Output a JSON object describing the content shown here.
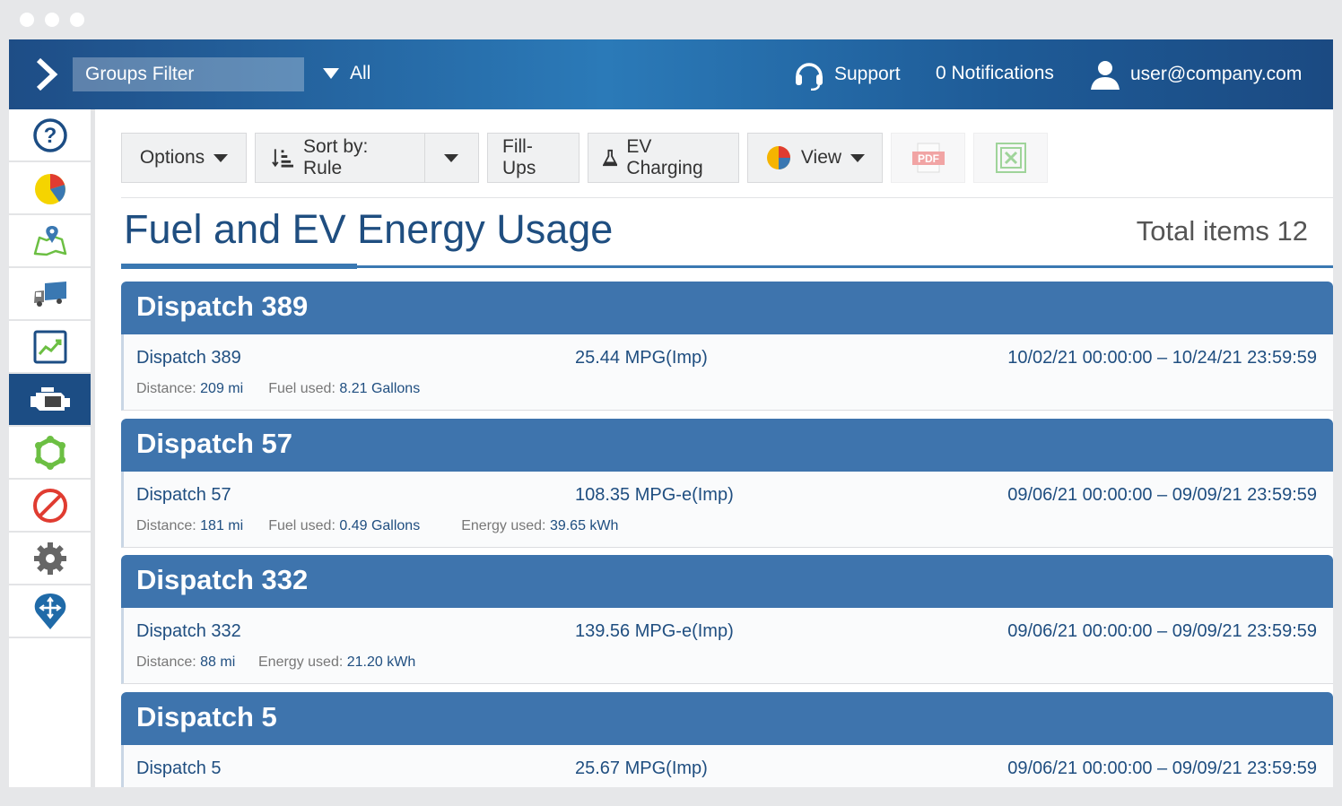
{
  "header": {
    "groups_filter": "Groups Filter",
    "scope": "All",
    "support": "Support",
    "notifications": "0 Notifications",
    "user": "user@company.com"
  },
  "sidebar": {
    "items": [
      {
        "icon": "help-icon"
      },
      {
        "icon": "pie-chart-icon"
      },
      {
        "icon": "map-pin-icon"
      },
      {
        "icon": "truck-icon"
      },
      {
        "icon": "trend-chart-icon"
      },
      {
        "icon": "engine-icon",
        "active": true
      },
      {
        "icon": "zone-icon"
      },
      {
        "icon": "no-entry-icon"
      },
      {
        "icon": "gear-icon"
      },
      {
        "icon": "navigate-icon"
      }
    ]
  },
  "toolbar": {
    "options": "Options",
    "sort": "Sort by: Rule",
    "fillups": "Fill-Ups",
    "ev_charging": "EV Charging",
    "view": "View",
    "pdf": "PDF"
  },
  "page": {
    "title": "Fuel and EV Energy Usage",
    "total": "Total items 12"
  },
  "labels": {
    "distance": "Distance:",
    "fuel": "Fuel used:",
    "energy": "Energy used:"
  },
  "dispatches": [
    {
      "title": "Dispatch 389",
      "name": "Dispatch 389",
      "efficiency": "25.44 MPG(Imp)",
      "range": "10/02/21 00:00:00 – 10/24/21 23:59:59",
      "distance": "209 mi",
      "fuel": "8.21 Gallons"
    },
    {
      "title": "Dispatch 57",
      "name": "Dispatch 57",
      "efficiency": "108.35 MPG-e(Imp)",
      "range": "09/06/21 00:00:00 – 09/09/21 23:59:59",
      "distance": "181 mi",
      "fuel": "0.49 Gallons",
      "energy": "39.65 kWh"
    },
    {
      "title": "Dispatch 332",
      "name": "Dispatch 332",
      "efficiency": "139.56 MPG-e(Imp)",
      "range": "09/06/21 00:00:00 – 09/09/21 23:59:59",
      "distance": "88 mi",
      "energy": "21.20 kWh"
    },
    {
      "title": "Dispatch 5",
      "name": "Dispatch 5",
      "efficiency": "25.67 MPG(Imp)",
      "range": "09/06/21 00:00:00 – 09/09/21 23:59:59"
    }
  ]
}
